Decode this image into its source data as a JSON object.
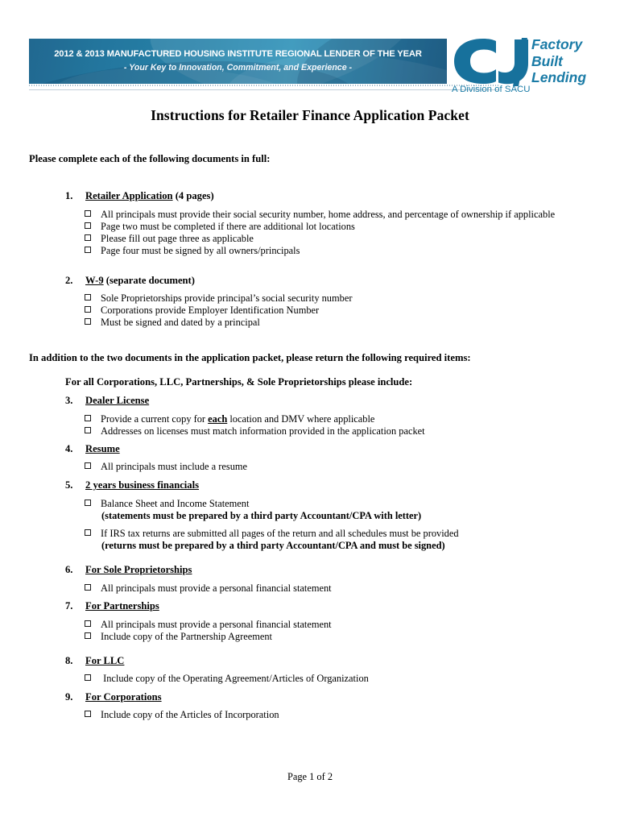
{
  "header": {
    "banner_line1": "2012 & 2013 MANUFACTURED HOUSING INSTITUTE REGIONAL LENDER OF THE YEAR",
    "banner_line2": "-  Your Key to Innovation, Commitment, and Experience  -",
    "logo_mark": "CU",
    "logo_word1": "Factory",
    "logo_word2": "Built",
    "logo_word3": "Lending",
    "logo_division": "A Division of SACU",
    "brand_color": "#1a7ba6",
    "banner_color": "#0f6a95"
  },
  "title": "Instructions for Retailer Finance Application Packet",
  "lead_1": "Please complete each of the following documents in full:",
  "lead_2": "In addition to the two documents in the application packet, please return the following required items:",
  "subhead": "For all Corporations, LLC, Partnerships, & Sole Proprietorships please include:",
  "items": [
    {
      "num": "1.",
      "title": "Retailer Application",
      "suffix": " (4 pages)",
      "checks": [
        "All principals must provide their social security number, home address, and percentage of ownership if applicable",
        "Page two must be completed if there are additional lot locations",
        "Please fill out page three as applicable",
        "Page four must be signed by all owners/principals"
      ]
    },
    {
      "num": "2.",
      "title": "W-9",
      "suffix": " (separate document)",
      "checks": [
        "Sole Proprietorships provide principal’s social security number",
        "Corporations provide Employer Identification Number",
        "Must be signed and dated by a principal"
      ]
    },
    {
      "num": "3.",
      "title": "Dealer License",
      "suffix": "",
      "checks": [
        "Provide a current copy for each location and DMV where applicable",
        "Addresses on licenses must match information provided in the application packet"
      ]
    },
    {
      "num": "4.",
      "title": "Resume",
      "suffix": "",
      "checks": [
        "All principals must include a resume"
      ]
    },
    {
      "num": "5.",
      "title": "2 years business financials",
      "suffix": "",
      "checks": [
        "Balance Sheet and Income Statement",
        "If IRS tax returns are submitted all pages of the return and all schedules must be provided"
      ],
      "sub_bold": [
        "(statements must be prepared by a third party Accountant/CPA with letter)",
        "(returns must be prepared by a third party Accountant/CPA and must be signed)"
      ]
    },
    {
      "num": "6.",
      "title": "For Sole Proprietorships",
      "suffix": "",
      "checks": [
        "All principals must provide a personal financial statement"
      ]
    },
    {
      "num": "7.",
      "title": "For Partnerships",
      "suffix": "",
      "checks": [
        "All principals must provide a personal financial statement",
        "Include copy of the Partnership Agreement"
      ]
    },
    {
      "num": "8.",
      "title": "For LLC",
      "suffix": "",
      "checks": [
        " Include copy of the Operating Agreement/Articles of Organization"
      ]
    },
    {
      "num": "9.",
      "title": "For Corporations",
      "suffix": "",
      "checks": [
        "Include copy of the Articles of Incorporation"
      ]
    }
  ],
  "check_3_1_parts": {
    "before": "Provide a current copy for ",
    "emphasis": "each",
    "after": " location and DMV where applicable"
  },
  "footer": "Page 1 of 2"
}
